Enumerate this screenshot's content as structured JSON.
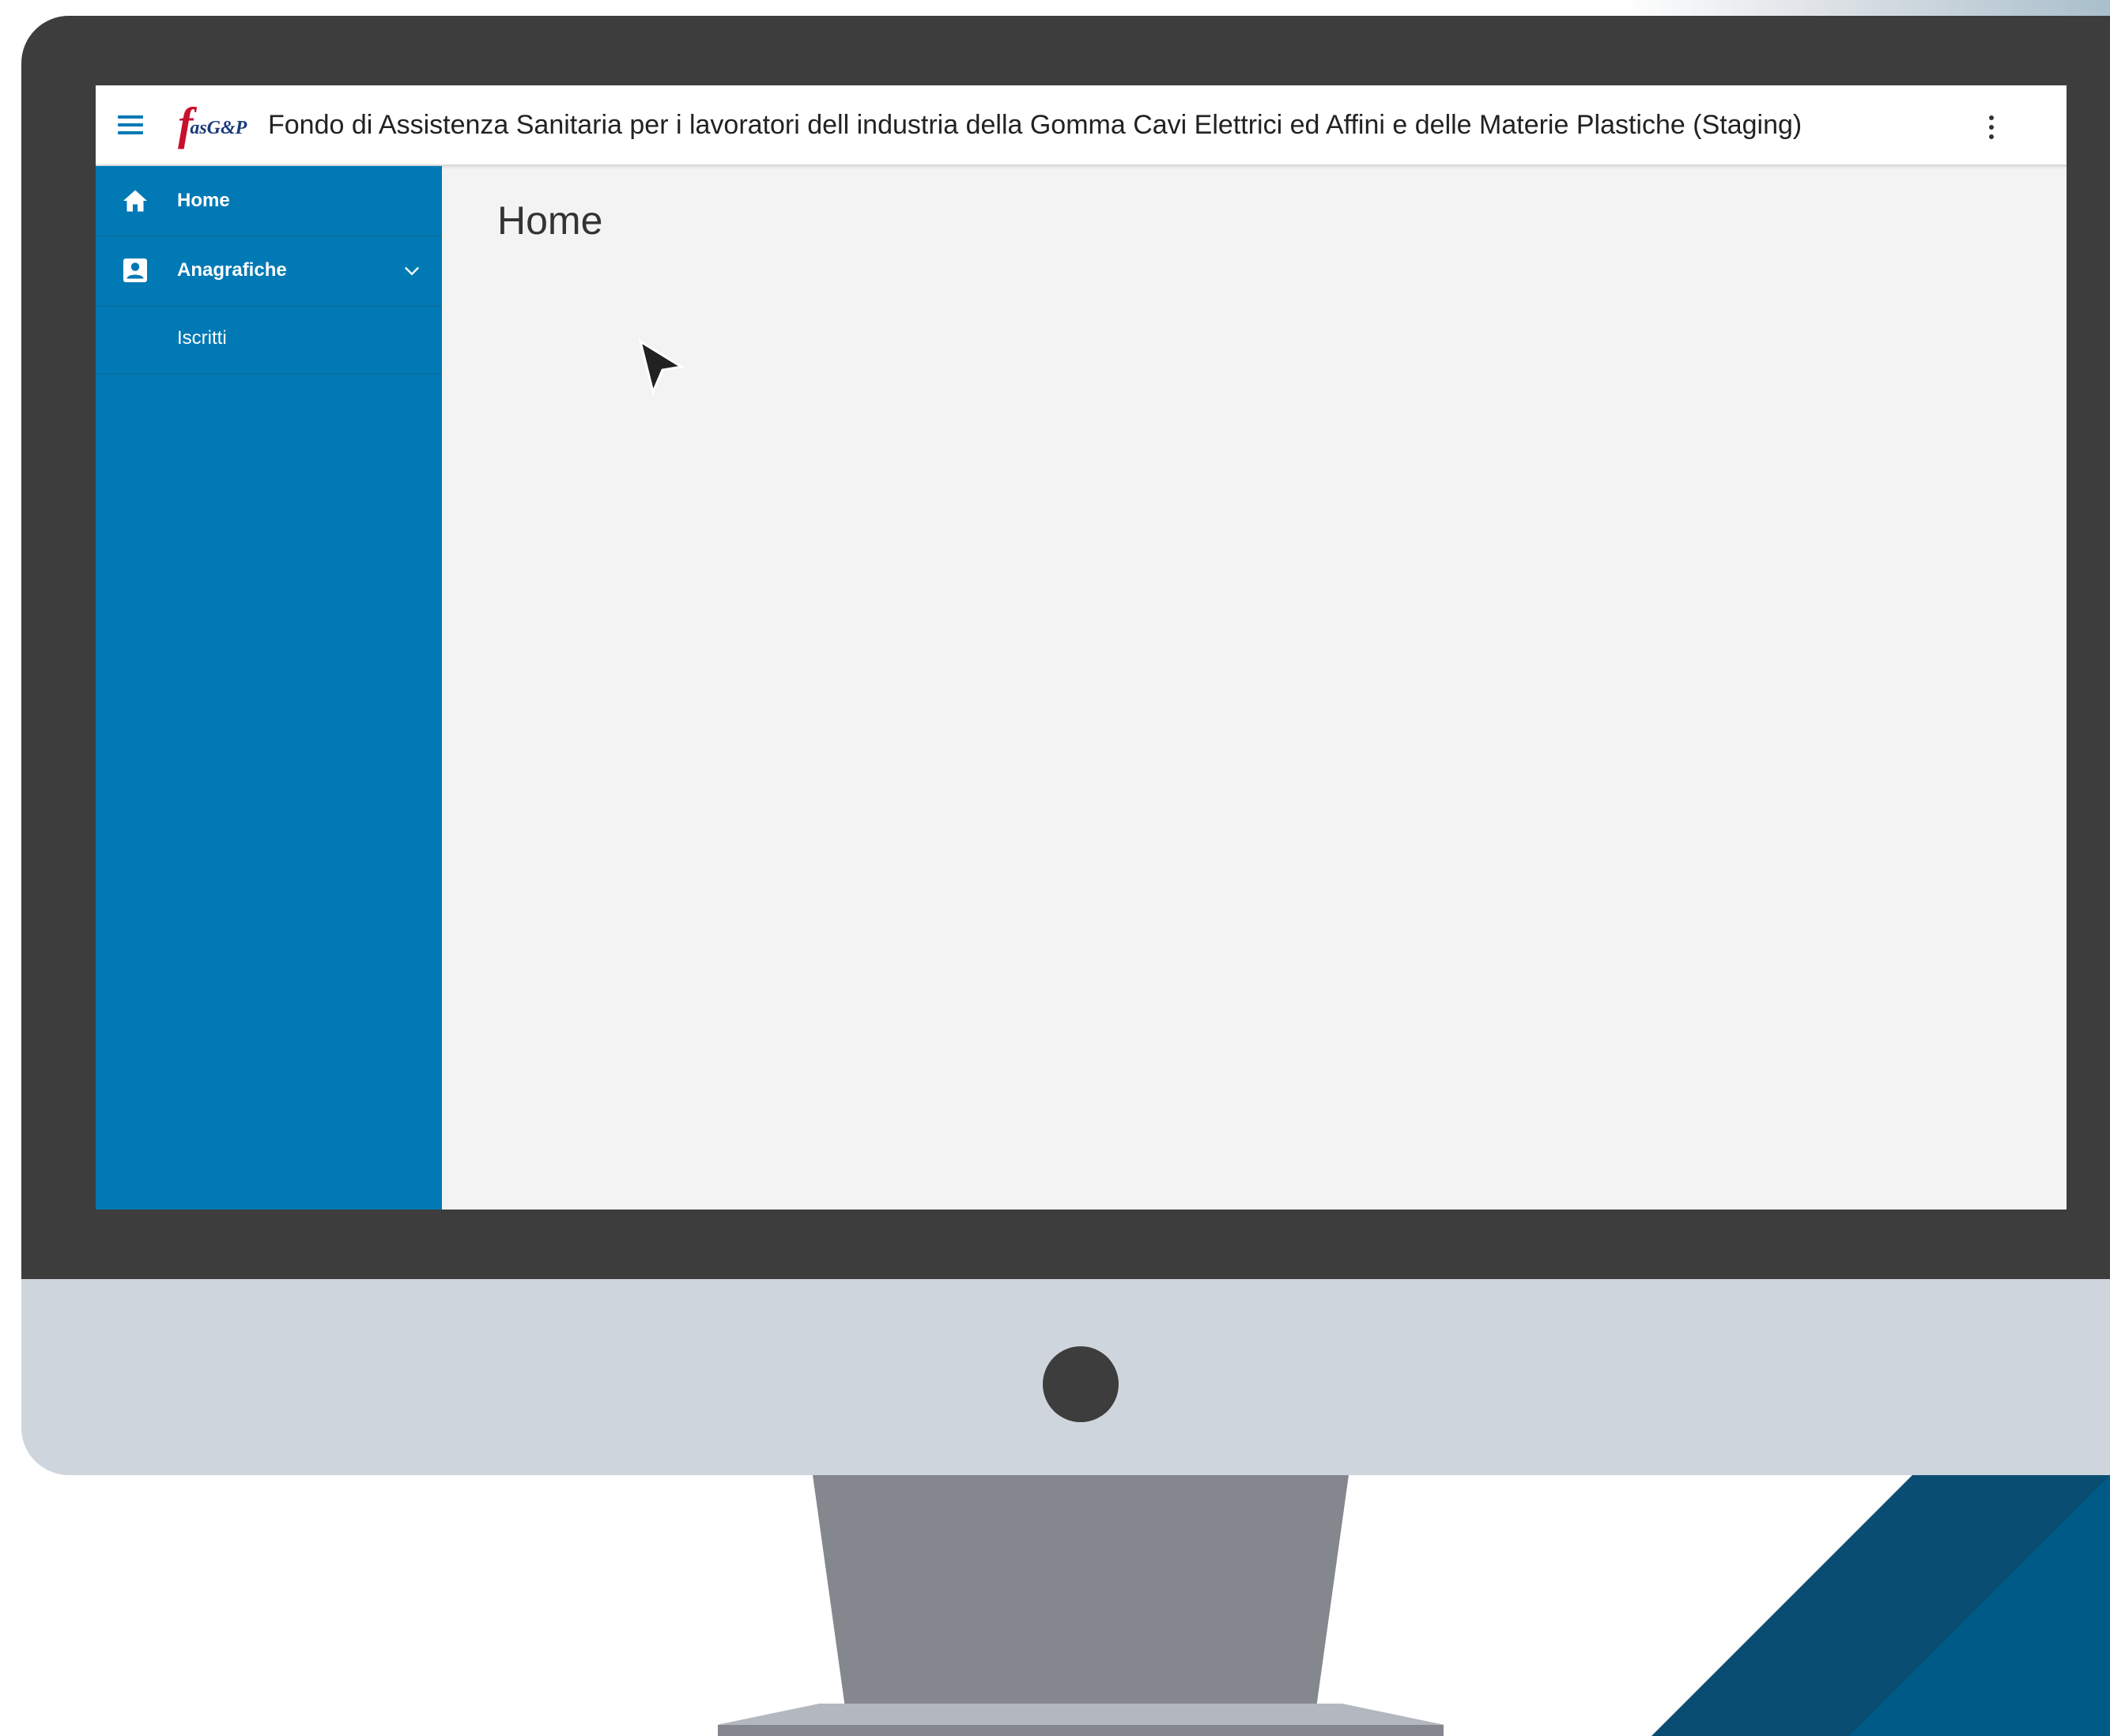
{
  "app": {
    "logo_text": "fasG&P",
    "title": "Fondo di Assistenza Sanitaria per i lavoratori dell industria della Gomma Cavi Elettrici ed Affini e delle Materie Plastiche (Staging)"
  },
  "sidebar": {
    "items": [
      {
        "label": "Home",
        "icon": "home-icon"
      },
      {
        "label": "Anagrafiche",
        "icon": "contact-card-icon",
        "expanded": true,
        "children": [
          {
            "label": "Iscritti"
          }
        ]
      }
    ]
  },
  "main": {
    "page_title": "Home"
  },
  "colors": {
    "primary": "#0079b5",
    "bezel": "#3d3d3d",
    "chin": "#cfd5dd"
  }
}
